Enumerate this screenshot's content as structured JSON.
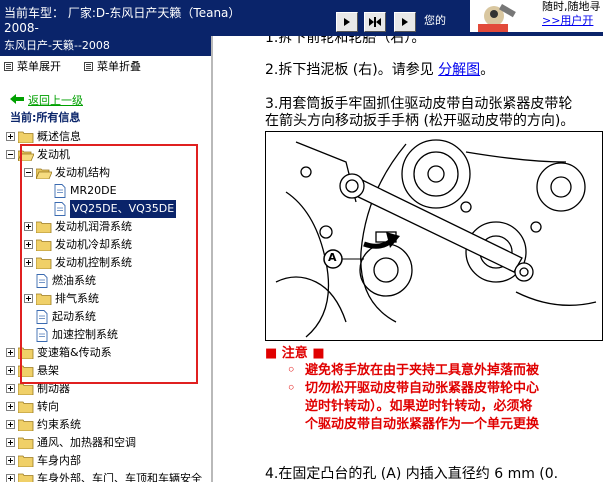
{
  "topbar": {
    "car_model": "当前车型： 厂家:D-东风日产天籁（Teana）2008-",
    "tip_text": "您的",
    "help_caption": "随时,随地寻",
    "user_link": ">>用户开"
  },
  "sidebar": {
    "brand_title": "东风日产-天籁--2008",
    "expand_all": "菜单展开",
    "collapse_all": "菜单折叠",
    "back_link": "返回上一级",
    "current_position": "当前:所有信息",
    "tree": [
      {
        "label": "概述信息",
        "level": 0,
        "type": "folder",
        "state": "plus"
      },
      {
        "label": "发动机",
        "level": 0,
        "type": "folder",
        "state": "minus"
      },
      {
        "label": "发动机结构",
        "level": 1,
        "type": "folder",
        "state": "minus"
      },
      {
        "label": "MR20DE",
        "level": 2,
        "type": "page"
      },
      {
        "label": "VQ25DE、VQ35DE",
        "level": 2,
        "type": "page",
        "selected": true
      },
      {
        "label": "发动机润滑系统",
        "level": 1,
        "type": "folder",
        "state": "plus"
      },
      {
        "label": "发动机冷却系统",
        "level": 1,
        "type": "folder",
        "state": "plus"
      },
      {
        "label": "发动机控制系统",
        "level": 1,
        "type": "folder",
        "state": "plus"
      },
      {
        "label": "燃油系统",
        "level": 1,
        "type": "page"
      },
      {
        "label": "排气系统",
        "level": 1,
        "type": "folder",
        "state": "plus"
      },
      {
        "label": "起动系统",
        "level": 1,
        "type": "page"
      },
      {
        "label": "加速控制系统",
        "level": 1,
        "type": "page"
      },
      {
        "label": "变速箱&传动系",
        "level": 0,
        "type": "folder",
        "state": "plus"
      },
      {
        "label": "悬架",
        "level": 0,
        "type": "folder",
        "state": "plus"
      },
      {
        "label": "制动器",
        "level": 0,
        "type": "folder",
        "state": "plus"
      },
      {
        "label": "转向",
        "level": 0,
        "type": "folder",
        "state": "plus"
      },
      {
        "label": "约束系统",
        "level": 0,
        "type": "folder",
        "state": "plus"
      },
      {
        "label": "通风、加热器和空调",
        "level": 0,
        "type": "folder",
        "state": "plus"
      },
      {
        "label": "车身内部",
        "level": 0,
        "type": "folder",
        "state": "plus"
      },
      {
        "label": "车身外部、车门、车顶和车辆安全",
        "level": 0,
        "type": "folder",
        "state": "plus"
      }
    ]
  },
  "content": {
    "step1": "1.拆下前轮和轮胎（右）。",
    "step2_prefix": "2.拆下挡泥板 (右)。请参见 ",
    "step2_link": "分解图",
    "step2_suffix": "。",
    "step3_line1": "3.用套筒扳手牢固抓住驱动皮带自动张紧器皮带轮",
    "step3_line2": "在箭头方向移动扳手手柄 (松开驱动皮带的方向)。",
    "figure_label": "A",
    "caution_title": "■ 注意 ■",
    "caution_1": "避免将手放在由于夹持工具意外掉落而被",
    "caution_2_line1": "切勿松开驱动皮带自动张紧器皮带轮中心",
    "caution_2_line2": "逆时针转动）。如果逆时针转动，必须将",
    "caution_2_line3": "个驱动皮带自动张紧器作为一个单元更换",
    "step4": "4.在固定凸台的孔 (A) 内插入直径约 6 mm (0."
  },
  "colors": {
    "title_bar": "#0a246a",
    "caution": "#e00000",
    "link": "#0000ee",
    "highlight_box": "#e02020"
  }
}
